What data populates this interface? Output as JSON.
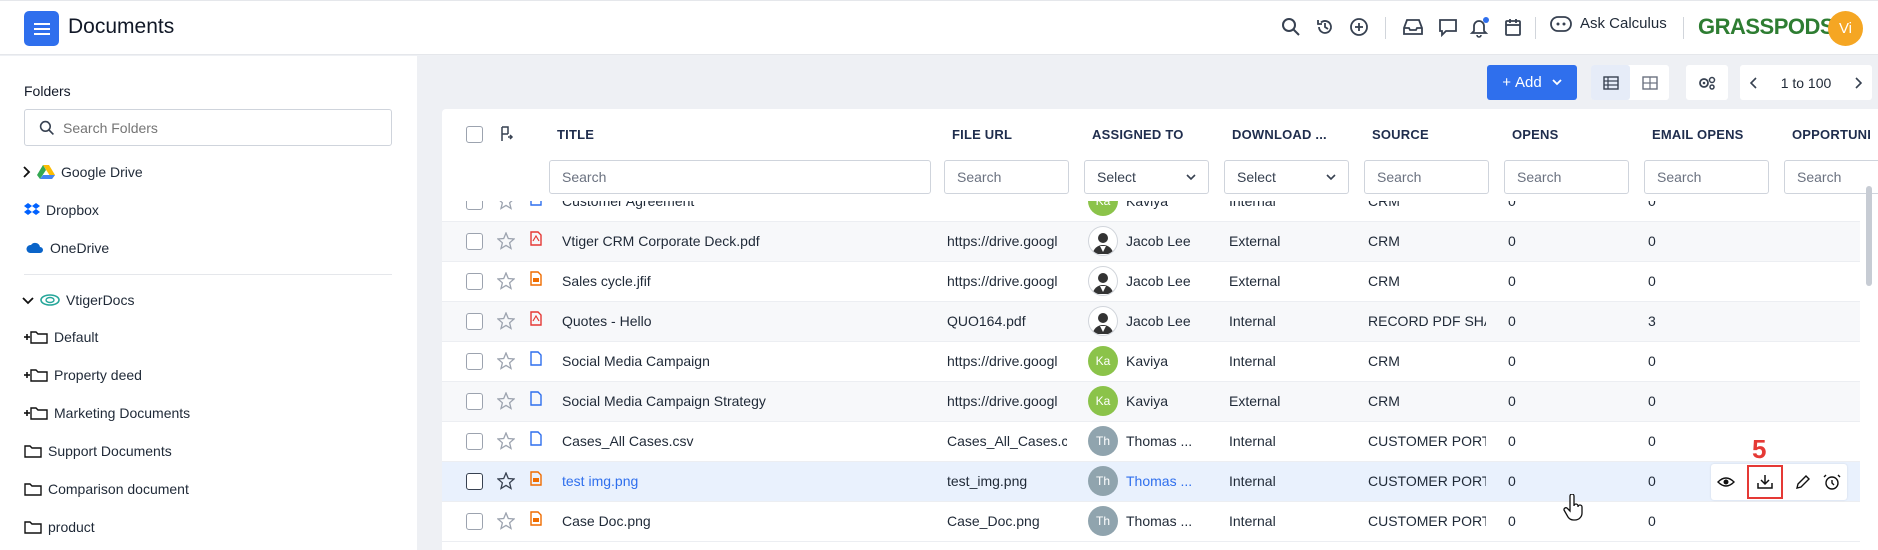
{
  "app": {
    "title": "Documents"
  },
  "topbar": {
    "ask_calculus": "Ask Calculus",
    "brand": "GRASSPODS",
    "avatar": "Vi"
  },
  "sidebar": {
    "heading": "Folders",
    "search_placeholder": "Search Folders",
    "items": [
      {
        "label": "Google Drive"
      },
      {
        "label": "Dropbox"
      },
      {
        "label": "OneDrive"
      },
      {
        "label": "VtigerDocs"
      },
      {
        "label": "Default"
      },
      {
        "label": "Property deed"
      },
      {
        "label": "Marketing Documents"
      },
      {
        "label": "Support Documents"
      },
      {
        "label": "Comparison document"
      },
      {
        "label": "product"
      }
    ]
  },
  "toolbar": {
    "add_label": "Add",
    "pager": "1 to 100"
  },
  "grid": {
    "columns": [
      "TITLE",
      "FILE URL",
      "ASSIGNED TO",
      "DOWNLOAD ...",
      "SOURCE",
      "OPENS",
      "EMAIL OPENS",
      "OPPORTUNI"
    ],
    "filters": {
      "search": "Search",
      "select": "Select"
    },
    "rows": [
      {
        "title": "Customer Agreement",
        "file_url": "",
        "assigned": "Kaviya",
        "avatar": "Ka",
        "download": "Internal",
        "source": "CRM",
        "opens": "0",
        "email_opens": "0"
      },
      {
        "title": "Vtiger CRM Corporate Deck.pdf",
        "file_url": "https://drive.googl",
        "assigned": "Jacob Lee",
        "avatar": "",
        "download": "External",
        "source": "CRM",
        "opens": "0",
        "email_opens": "0"
      },
      {
        "title": "Sales cycle.jfif",
        "file_url": "https://drive.googl",
        "assigned": "Jacob Lee",
        "avatar": "",
        "download": "External",
        "source": "CRM",
        "opens": "0",
        "email_opens": "0"
      },
      {
        "title": "Quotes - Hello",
        "file_url": "QUO164.pdf",
        "assigned": "Jacob Lee",
        "avatar": "",
        "download": "Internal",
        "source": "RECORD PDF SHARI",
        "opens": "0",
        "email_opens": "3"
      },
      {
        "title": "Social Media Campaign",
        "file_url": "https://drive.googl",
        "assigned": "Kaviya",
        "avatar": "Ka",
        "download": "Internal",
        "source": "CRM",
        "opens": "0",
        "email_opens": "0"
      },
      {
        "title": "Social Media Campaign Strategy",
        "file_url": "https://drive.googl",
        "assigned": "Kaviya",
        "avatar": "Ka",
        "download": "External",
        "source": "CRM",
        "opens": "0",
        "email_opens": "0"
      },
      {
        "title": "Cases_All Cases.csv",
        "file_url": "Cases_All_Cases.c",
        "assigned": "Thomas ...",
        "avatar": "Th",
        "download": "Internal",
        "source": "CUSTOMER PORTAL",
        "opens": "0",
        "email_opens": "0"
      },
      {
        "title": "test img.png",
        "file_url": "test_img.png",
        "assigned": "Thomas ...",
        "avatar": "Th",
        "download": "Internal",
        "source": "CUSTOMER PORTAL",
        "opens": "0",
        "email_opens": "0"
      },
      {
        "title": "Case Doc.png",
        "file_url": "Case_Doc.png",
        "assigned": "Thomas ...",
        "avatar": "Th",
        "download": "Internal",
        "source": "CUSTOMER PORTAL",
        "opens": "0",
        "email_opens": "0"
      }
    ]
  },
  "annotation": {
    "label": "5"
  },
  "colors": {
    "accent": "#2f6fed",
    "annotation": "#e53935",
    "link": "#2f6fed"
  }
}
